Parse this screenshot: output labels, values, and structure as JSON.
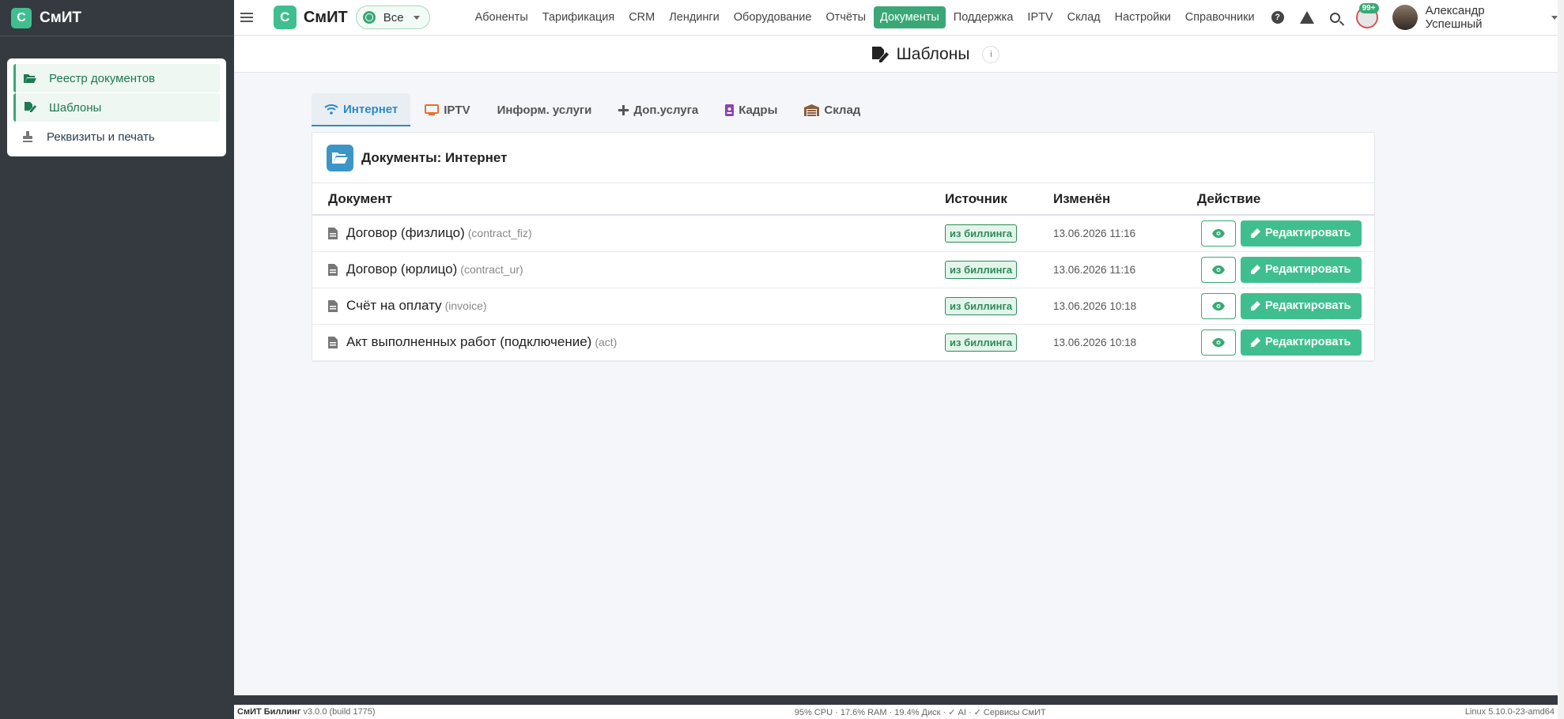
{
  "app": {
    "brand": "СмИТ",
    "logo_letter": "С"
  },
  "sidebar": {
    "items": [
      {
        "label": "Реестр документов",
        "icon": "folder-open-icon",
        "active": true
      },
      {
        "label": "Шаблоны",
        "icon": "file-signature-icon",
        "active": true
      },
      {
        "label": "Реквизиты и печать",
        "icon": "stamp-icon",
        "active": false
      }
    ]
  },
  "topbar": {
    "filter_label": "Все",
    "nav": [
      "Абоненты",
      "Тарификация",
      "CRM",
      "Лендинги",
      "Оборудование",
      "Отчёты",
      "Документы",
      "Поддержка",
      "IPTV",
      "Склад",
      "Настройки",
      "Справочники"
    ],
    "active_nav": "Документы",
    "notif_badge": "99+",
    "help_glyph": "?",
    "user_name": "Александр Успешный"
  },
  "page": {
    "title": "Шаблоны",
    "info_glyph": "i"
  },
  "tabs": [
    {
      "label": "Интернет",
      "icon": "wifi-icon",
      "active": true
    },
    {
      "label": "IPTV",
      "icon": "tv-icon",
      "active": false
    },
    {
      "label": "Информ. услуги",
      "icon": "",
      "active": false
    },
    {
      "label": "Доп.услуга",
      "icon": "plus-icon",
      "active": false
    },
    {
      "label": "Кадры",
      "icon": "id-badge-icon",
      "active": false
    },
    {
      "label": "Склад",
      "icon": "warehouse-icon",
      "active": false
    }
  ],
  "card": {
    "title": "Документы: Интернет",
    "columns": {
      "doc": "Документ",
      "source": "Источник",
      "modified": "Изменён",
      "action": "Действие"
    },
    "rows": [
      {
        "name": "Договор (физлицо)",
        "code": "(contract_fiz)",
        "source": "из биллинга",
        "modified": "13.06.2026 11:16"
      },
      {
        "name": "Договор (юрлицо)",
        "code": "(contract_ur)",
        "source": "из биллинга",
        "modified": "13.06.2026 11:16"
      },
      {
        "name": "Счёт на оплату",
        "code": "(invoice)",
        "source": "из биллинга",
        "modified": "13.06.2026 10:18"
      },
      {
        "name": "Акт выполненных работ (подключение)",
        "code": "(act)",
        "source": "из биллинга",
        "modified": "13.06.2026 10:18"
      }
    ],
    "edit_label": "Редактировать"
  },
  "footer": {
    "product": "СмИТ Биллинг",
    "version": "v3.0.0 (build 1775)",
    "stats": "95% CPU · 17.6% RAM · 19.4% Диск · ✓ AI · ✓ Сервисы СмИТ",
    "os": "Linux 5.10.0-23-amd64"
  },
  "colors": {
    "accent": "#3fbf8f",
    "sidebar": "#343a40",
    "tab_active": "#2b8ac6",
    "folder": "#3b96c8"
  }
}
